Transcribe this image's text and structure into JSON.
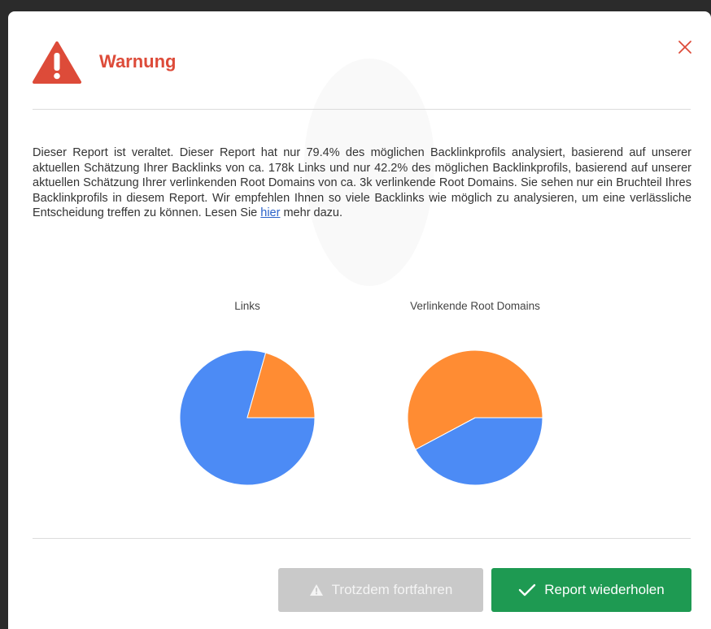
{
  "dialog": {
    "title": "Warnung",
    "icons": {
      "warning": "warning-triangle-icon",
      "close": "close-icon"
    },
    "colors": {
      "title": "#dd4b39",
      "primary": "#1e9a52",
      "disabled": "#c9c9c9",
      "link": "#2a62c9"
    }
  },
  "message": {
    "text_before_link": "Dieser Report ist veraltet. Dieser Report hat nur 79.4% des möglichen Backlinkprofils analysiert, basierend auf unserer aktuellen Schätzung Ihrer Backlinks von ca. 178k Links und nur 42.2% des möglichen Backlinkprofils, basierend auf unserer aktuellen Schätzung Ihrer verlinkenden Root Domains von ca. 3k verlinkende Root Domains. Sie sehen nur ein Bruchteil Ihres Backlinkprofils in diesem Report. Wir empfehlen Ihnen so viele Backlinks wie möglich zu analysieren, um eine verlässliche Entscheidung treffen zu können. Lesen Sie ",
    "link_text": "hier",
    "text_after_link": " mehr dazu."
  },
  "chart_data": [
    {
      "type": "pie",
      "title": "Links",
      "slices": [
        {
          "value": 79.4,
          "color": "#4c8bf5"
        },
        {
          "value": 20.6,
          "color": "#ff8c33"
        }
      ]
    },
    {
      "type": "pie",
      "title": "Verlinkende Root Domains",
      "slices": [
        {
          "value": 42.2,
          "color": "#4c8bf5"
        },
        {
          "value": 57.8,
          "color": "#ff8c33"
        }
      ]
    }
  ],
  "buttons": {
    "continue_label": "Trotzdem fortfahren",
    "continue_icon": "warning-icon",
    "repeat_label": "Report wiederholen",
    "repeat_icon": "check-icon"
  }
}
